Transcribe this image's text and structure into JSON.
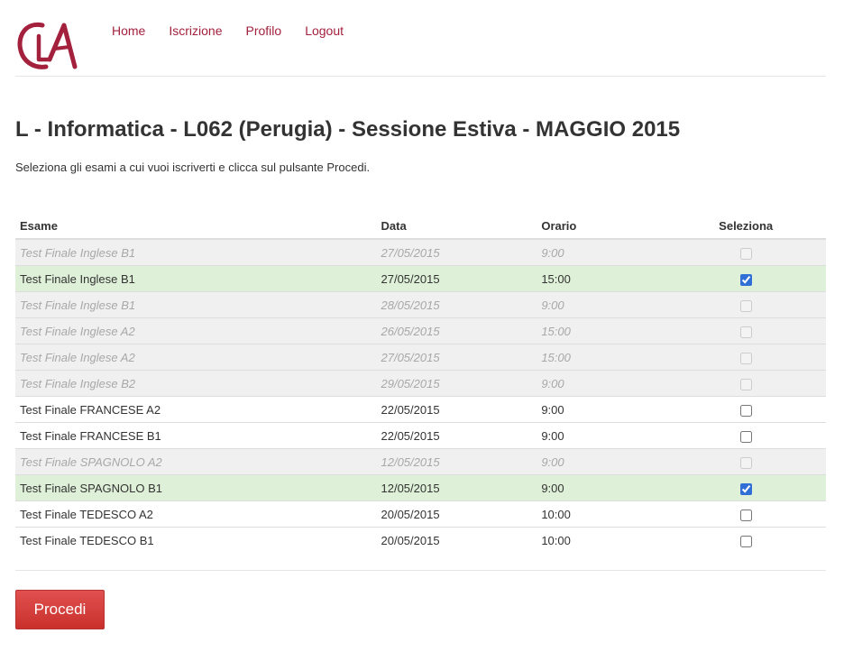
{
  "header": {
    "logo_text": "CLA",
    "nav": [
      "Home",
      "Iscrizione",
      "Profilo",
      "Logout"
    ]
  },
  "page": {
    "title": "L - Informatica - L062 (Perugia) - Sessione Estiva - MAGGIO 2015",
    "subtitle": "Seleziona gli esami a cui vuoi iscriverti e clicca sul pulsante Procedi."
  },
  "table": {
    "columns": [
      "Esame",
      "Data",
      "Orario",
      "Seleziona"
    ],
    "rows": [
      {
        "name": "Test Finale Inglese B1",
        "date": "27/05/2015",
        "time": "9:00",
        "state": "disabled",
        "checked": false
      },
      {
        "name": "Test Finale Inglese B1",
        "date": "27/05/2015",
        "time": "15:00",
        "state": "selected",
        "checked": true
      },
      {
        "name": "Test Finale Inglese B1",
        "date": "28/05/2015",
        "time": "9:00",
        "state": "disabled",
        "checked": false
      },
      {
        "name": "Test Finale Inglese A2",
        "date": "26/05/2015",
        "time": "15:00",
        "state": "disabled",
        "checked": false
      },
      {
        "name": "Test Finale Inglese A2",
        "date": "27/05/2015",
        "time": "15:00",
        "state": "disabled",
        "checked": false
      },
      {
        "name": "Test Finale Inglese B2",
        "date": "29/05/2015",
        "time": "9:00",
        "state": "disabled",
        "checked": false
      },
      {
        "name": "Test Finale FRANCESE A2",
        "date": "22/05/2015",
        "time": "9:00",
        "state": "normal",
        "checked": false
      },
      {
        "name": "Test Finale FRANCESE B1",
        "date": "22/05/2015",
        "time": "9:00",
        "state": "normal",
        "checked": false
      },
      {
        "name": "Test Finale SPAGNOLO A2",
        "date": "12/05/2015",
        "time": "9:00",
        "state": "disabled",
        "checked": false
      },
      {
        "name": "Test Finale SPAGNOLO B1",
        "date": "12/05/2015",
        "time": "9:00",
        "state": "selected",
        "checked": true
      },
      {
        "name": "Test Finale TEDESCO A2",
        "date": "20/05/2015",
        "time": "10:00",
        "state": "normal",
        "checked": false
      },
      {
        "name": "Test Finale TEDESCO B1",
        "date": "20/05/2015",
        "time": "10:00",
        "state": "normal",
        "checked": false
      }
    ]
  },
  "actions": {
    "submit_label": "Procedi"
  },
  "colors": {
    "brand": "#a3213c",
    "row_disabled": "#f0f0f0",
    "row_selected": "#dff0d8",
    "button": "#d9534f"
  }
}
